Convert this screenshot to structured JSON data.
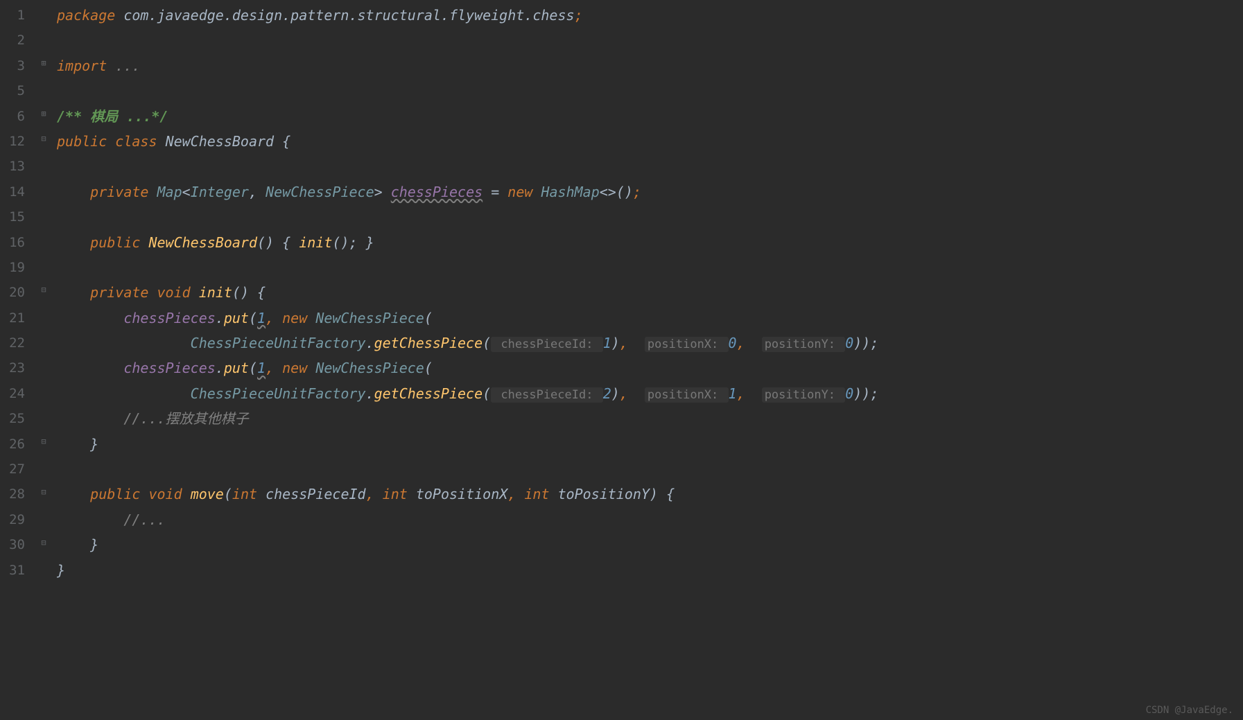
{
  "gutter": [
    "1",
    "2",
    "3",
    "5",
    "6",
    "12",
    "13",
    "14",
    "15",
    "16",
    "19",
    "20",
    "21",
    "22",
    "23",
    "24",
    "25",
    "26",
    "27",
    "28",
    "29",
    "30",
    "31"
  ],
  "code": {
    "l1": {
      "kw": "package",
      "pkg": " com.javaedge.design.pattern.structural.flyweight.chess",
      "sc": ";"
    },
    "l3": {
      "kw": "import",
      "rest": " ..."
    },
    "l6": {
      "doc": "/** 棋局 ...*/"
    },
    "l12": {
      "mod": "public",
      "cls_kw": "class",
      "name": "NewChessBoard",
      "brace": "{"
    },
    "l14": {
      "mod": "private",
      "type": "Map",
      "gen_open": "<",
      "g1": "Integer",
      "comma": ", ",
      "g2": "NewChessPiece",
      "gen_close": ">",
      "field": "chessPieces",
      "eq": " = ",
      "new": "new",
      "hash": "HashMap",
      "diam": "<>()",
      "sc": ";"
    },
    "l16": {
      "mod": "public",
      "ctor": "NewChessBoard",
      "par": "()",
      "bo": "{",
      "call": "init",
      "callp": "();",
      "bc": "}"
    },
    "l20": {
      "mod": "private",
      "ret": "void",
      "m": "init",
      "par": "()",
      "bo": "{"
    },
    "l21": {
      "field": "chessPieces",
      "dot": ".",
      "put": "put",
      "po": "(",
      "arg1": "1",
      "comma": ", ",
      "new": "new",
      "cls": "NewChessPiece",
      "po2": "("
    },
    "l22": {
      "fact": "ChessPieceUnitFactory",
      "dot": ".",
      "get": "getChessPiece",
      "po": "(",
      "ph1": " chessPieceId: ",
      "v1": "1",
      "pc": ")",
      "comma": ",  ",
      "ph2": "positionX: ",
      "v2": "0",
      "comma2": ",  ",
      "ph3": "positionY: ",
      "v3": "0",
      "end": "));"
    },
    "l23": {
      "field": "chessPieces",
      "dot": ".",
      "put": "put",
      "po": "(",
      "arg1": "1",
      "comma": ", ",
      "new": "new",
      "cls": "NewChessPiece",
      "po2": "("
    },
    "l24": {
      "fact": "ChessPieceUnitFactory",
      "dot": ".",
      "get": "getChessPiece",
      "po": "(",
      "ph1": " chessPieceId: ",
      "v1": "2",
      "pc": ")",
      "comma": ",  ",
      "ph2": "positionX: ",
      "v2": "1",
      "comma2": ",  ",
      "ph3": "positionY: ",
      "v3": "0",
      "end": "));"
    },
    "l25": {
      "cmt": "//...摆放其他棋子"
    },
    "l26": {
      "bc": "}"
    },
    "l28": {
      "mod": "public",
      "ret": "void",
      "m": "move",
      "po": "(",
      "t1": "int",
      "p1": "chessPieceId",
      "c1": ", ",
      "t2": "int",
      "p2": "toPositionX",
      "c2": ", ",
      "t3": "int",
      "p3": "toPositionY",
      "pc": ")",
      "bo": "{"
    },
    "l29": {
      "cmt": "//..."
    },
    "l30": {
      "bc": "}"
    },
    "l31": {
      "bc": "}"
    }
  },
  "watermark": "CSDN @JavaEdge."
}
